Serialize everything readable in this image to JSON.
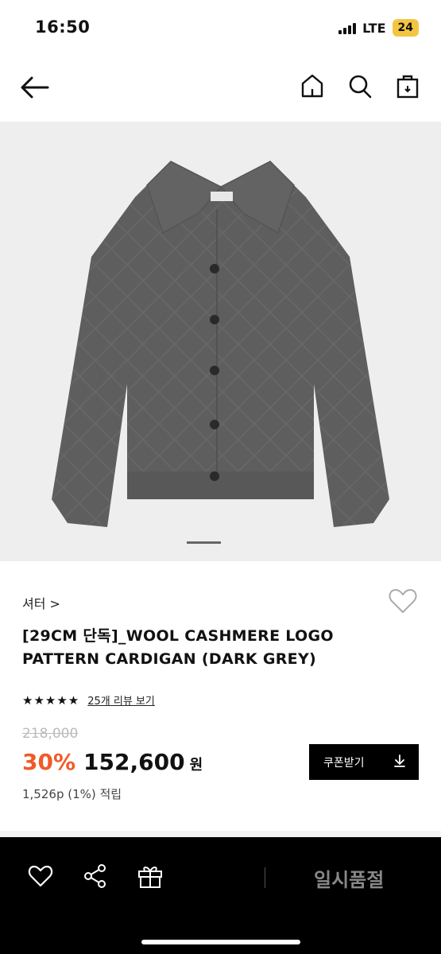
{
  "status_bar": {
    "time": "16:50",
    "network": "LTE",
    "battery": "24"
  },
  "header": {
    "icons": [
      "back-arrow-icon",
      "home-icon",
      "search-icon",
      "shopping-bag-icon"
    ]
  },
  "product": {
    "image_alt_colors": {
      "background": "#eeeeee",
      "cardigan": "#5e5e5e"
    },
    "category": "셔터 >",
    "title": "[29CM 단독]_WOOL CASHMERE LOGO PATTERN CARDIGAN (DARK GREY)",
    "rating_stars": "★★★★★",
    "rating_value": 5,
    "reviews_link": "25개 리뷰 보기",
    "original_price": "218,000",
    "discount": "30%",
    "price": "152,600",
    "currency": "원",
    "points": "1,526p (1%) 적립",
    "coupon_button": "쿠폰받기"
  },
  "bottom_bar": {
    "icons": [
      "heart-icon",
      "share-icon",
      "gift-icon"
    ],
    "status": "일시품절"
  },
  "colors": {
    "accent": "#f05a28",
    "dark": "#000000"
  }
}
